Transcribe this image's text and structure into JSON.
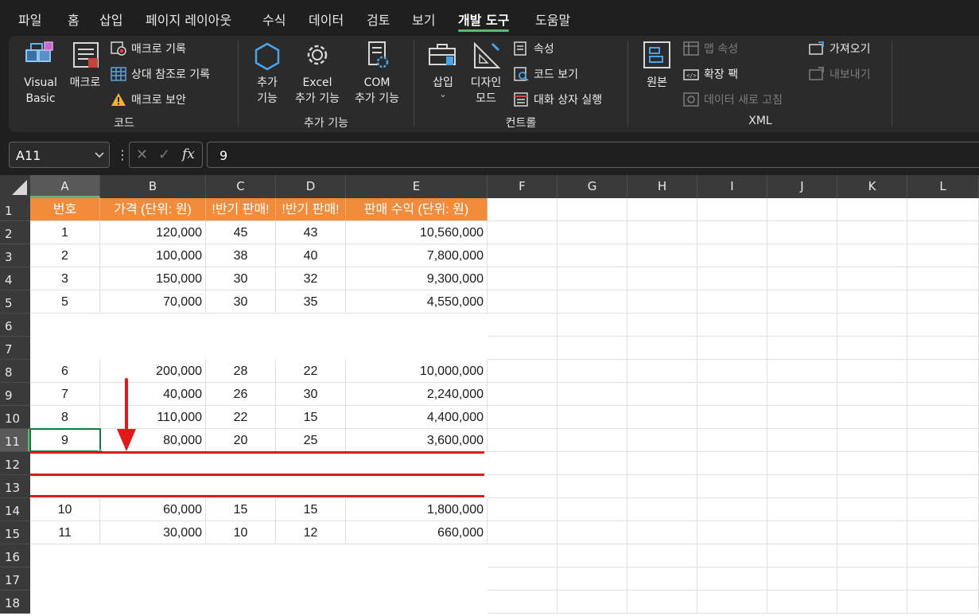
{
  "menu": {
    "tabs": [
      "파일",
      "홈",
      "삽입",
      "페이지 레이아웃",
      "수식",
      "데이터",
      "검토",
      "보기",
      "개발 도구",
      "도움말"
    ],
    "active_tab": "개발 도구"
  },
  "ribbon": {
    "code_group": {
      "label": "코드",
      "visual_basic": "Visual\nBasic",
      "macros": "매크로",
      "record_macro": "매크로 기록",
      "relative_ref": "상대 참조로 기록",
      "macro_security": "매크로 보안"
    },
    "addins_group": {
      "label": "추가 기능",
      "addins": "추가\n기능",
      "excel_addins": "Excel\n추가 기능",
      "com_addins": "COM\n추가 기능"
    },
    "controls_group": {
      "label": "컨트롤",
      "insert": "삽입",
      "design_mode": "디자인\n모드",
      "properties": "속성",
      "view_code": "코드 보기",
      "run_dialog": "대화 상자 실행"
    },
    "xml_group": {
      "label": "XML",
      "source": "원본",
      "map_properties": "맵 속성",
      "expansion_packs": "확장 팩",
      "refresh_data": "데이터 새로 고침",
      "import": "가져오기",
      "export": "내보내기"
    },
    "colors": {
      "bg": "#2b2b2b",
      "accent": "#5fb86e"
    }
  },
  "formula_bar": {
    "name_box": "A11",
    "cancel_symbol": "✕",
    "enter_symbol": "✓",
    "fx_symbol": "fx",
    "formula": "9"
  },
  "sheet": {
    "columns": [
      "A",
      "B",
      "C",
      "D",
      "E",
      "F",
      "G",
      "H",
      "I",
      "J",
      "K",
      "L"
    ],
    "selected_column": "A",
    "rows": [
      "1",
      "2",
      "3",
      "4",
      "5",
      "6",
      "7",
      "8",
      "9",
      "10",
      "11",
      "12",
      "13",
      "14",
      "15",
      "16",
      "17",
      "18"
    ],
    "selected_row": "11",
    "active_cell": "A11",
    "header_fill": "#f08c3c",
    "header_labels": [
      "번호",
      "가격 (단위: 원)",
      "!반기 판매!",
      "!반기 판매!",
      "판매 수익 (단위: 원)"
    ],
    "data": [
      [
        "1",
        "120,000",
        "45",
        "43",
        "10,560,000"
      ],
      [
        "2",
        "100,000",
        "38",
        "40",
        "7,800,000"
      ],
      [
        "3",
        "150,000",
        "30",
        "32",
        "9,300,000"
      ],
      [
        "5",
        "70,000",
        "30",
        "35",
        "4,550,000"
      ],
      [
        "",
        "",
        "",
        "",
        ""
      ],
      [
        "",
        "",
        "",
        "",
        ""
      ],
      [
        "6",
        "200,000",
        "28",
        "22",
        "10,000,000"
      ],
      [
        "7",
        "40,000",
        "26",
        "30",
        "2,240,000"
      ],
      [
        "8",
        "110,000",
        "22",
        "15",
        "4,400,000"
      ],
      [
        "9",
        "80,000",
        "20",
        "25",
        "3,600,000"
      ],
      [
        "",
        "",
        "",
        "",
        ""
      ],
      [
        "",
        "",
        "",
        "",
        ""
      ],
      [
        "10",
        "60,000",
        "15",
        "15",
        "1,800,000"
      ],
      [
        "11",
        "30,000",
        "10",
        "12",
        "660,000"
      ]
    ]
  },
  "annotations": {
    "arrow_icon": "red-down-arrow-icon",
    "underline_color": "#e01919"
  }
}
